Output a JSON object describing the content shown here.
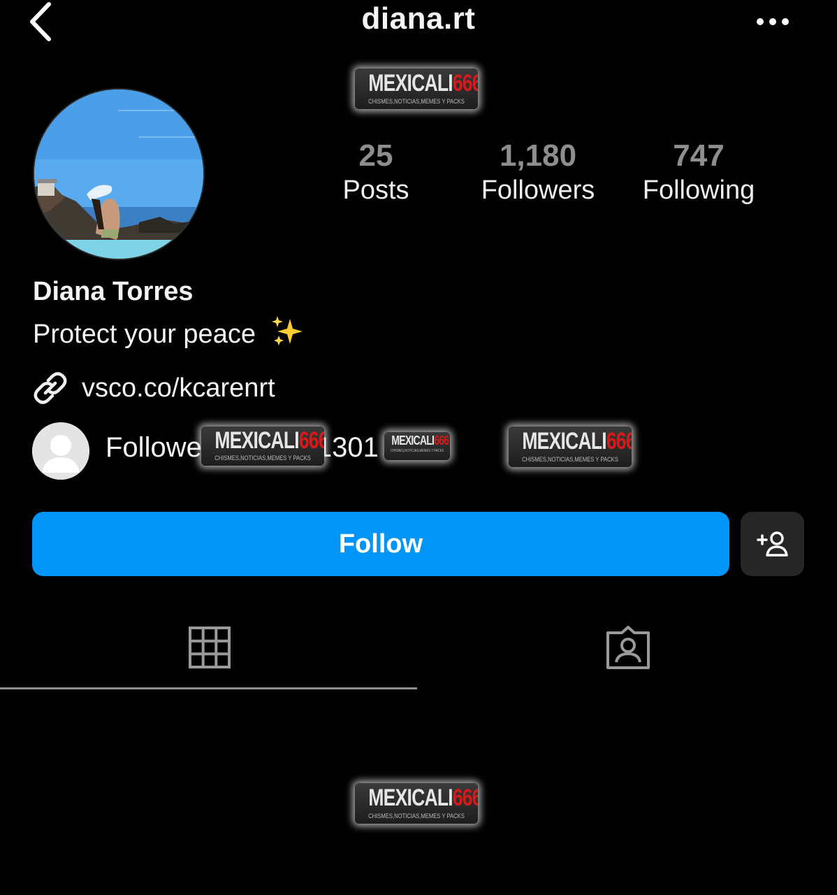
{
  "header": {
    "username": "diana.rt",
    "back_icon": "chevron-left-icon",
    "more_icon": "more-horizontal-icon"
  },
  "watermark": {
    "brand_main": "MEXICALI",
    "brand_number": "666",
    "tagline": "CHISMES,NOTICIAS,MEMES Y PACKS"
  },
  "profile": {
    "full_name": "Diana Torres",
    "bio": "Protect your peace",
    "bio_emoji": "✨",
    "link": "vsco.co/kcarenrt",
    "link_icon": "link-icon"
  },
  "stats": {
    "posts": {
      "value": "25",
      "label": "Posts"
    },
    "followers": {
      "value": "1,180",
      "label": "Followers"
    },
    "following": {
      "value": "747",
      "label": "Following"
    }
  },
  "followed_by": {
    "prefix": "Followe",
    "suffix": "1301"
  },
  "actions": {
    "follow_label": "Follow",
    "suggest_icon": "add-person-icon"
  },
  "tabs": [
    {
      "name": "posts-grid",
      "icon": "grid-icon",
      "active": true
    },
    {
      "name": "tagged",
      "icon": "tagged-person-icon",
      "active": false
    }
  ],
  "colors": {
    "background": "#000000",
    "follow_button": "#0095f6",
    "secondary_button": "#262626",
    "stat_number": "#8e8e8e",
    "watermark_accent": "#d61a1a"
  }
}
